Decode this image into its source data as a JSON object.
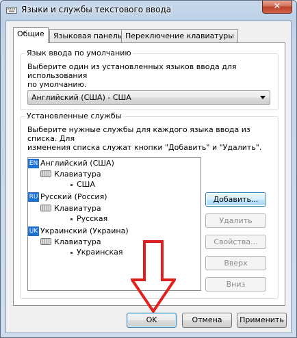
{
  "window": {
    "title": "Языки и службы текстового ввода",
    "close_label": "✕"
  },
  "tabs": [
    {
      "label": "Общие",
      "active": true
    },
    {
      "label": "Языковая панель",
      "active": false
    },
    {
      "label": "Переключение клавиатуры",
      "active": false
    }
  ],
  "default_language": {
    "group_title": "Язык ввода по умолчанию",
    "description_line1": "Выберите один из установленных языков ввода для использования",
    "description_line2": "по умолчанию.",
    "selected_value": "Английский (США) - США"
  },
  "installed_services": {
    "group_title": "Установленные службы",
    "description_line1": "Выберите нужные службы для каждого языка ввода из списка. Для",
    "description_line2": "изменения списка служат кнопки \"Добавить\" и \"Удалить\".",
    "languages": [
      {
        "badge": "EN",
        "name": "Английский (США)",
        "category": "Клавиатура",
        "layout": "США"
      },
      {
        "badge": "RU",
        "name": "Русский (Россия)",
        "category": "Клавиатура",
        "layout": "Русская"
      },
      {
        "badge": "UK",
        "name": "Украинский (Украина)",
        "category": "Клавиатура",
        "layout": "Украинская"
      }
    ],
    "buttons": {
      "add": "Добавить...",
      "remove": "Удалить",
      "properties": "Свойства...",
      "up": "Вверх",
      "down": "Вниз"
    }
  },
  "footer": {
    "ok": "OK",
    "cancel": "Отмена",
    "apply": "Применить"
  },
  "annotation": {
    "arrow_color": "#e0201e",
    "arrow_icon": "down-arrow-icon"
  },
  "colors": {
    "badge": "#1c70d0",
    "close_button": "#c7503a"
  }
}
